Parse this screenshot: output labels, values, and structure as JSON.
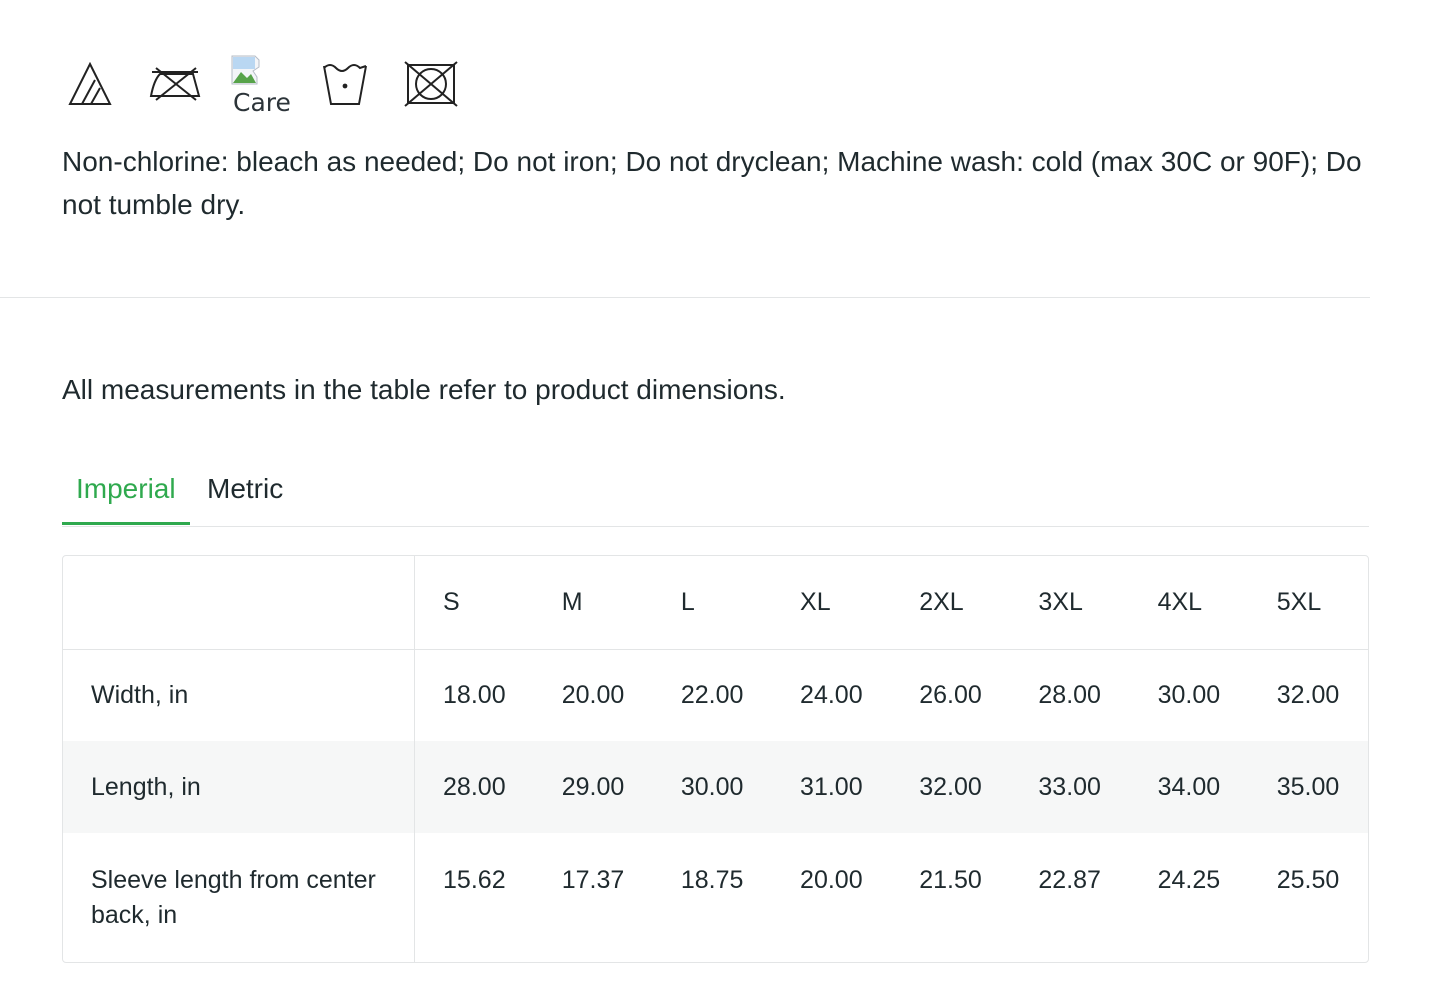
{
  "care": {
    "icons": [
      "non-chlorine-bleach-icon",
      "do-not-iron-icon",
      "broken-image-icon",
      "machine-wash-cold-icon",
      "do-not-tumble-dry-icon"
    ],
    "broken_image_alt": "Care",
    "instructions": "Non-chlorine: bleach as needed; Do not iron; Do not dryclean; Machine wash: cold (max 30C or 90F); Do not tumble dry."
  },
  "measurements": {
    "note": "All measurements in the table refer to product dimensions.",
    "tabs": [
      {
        "label": "Imperial",
        "active": true
      },
      {
        "label": "Metric",
        "active": false
      }
    ],
    "active_color": "#2fa94e",
    "sizes": [
      "S",
      "M",
      "L",
      "XL",
      "2XL",
      "3XL",
      "4XL",
      "5XL"
    ],
    "rows": [
      {
        "label": "Width, in",
        "values": [
          "18.00",
          "20.00",
          "22.00",
          "24.00",
          "26.00",
          "28.00",
          "30.00",
          "32.00"
        ]
      },
      {
        "label": "Length, in",
        "values": [
          "28.00",
          "29.00",
          "30.00",
          "31.00",
          "32.00",
          "33.00",
          "34.00",
          "35.00"
        ]
      },
      {
        "label": "Sleeve length from center back, in",
        "values": [
          "15.62",
          "17.37",
          "18.75",
          "20.00",
          "21.50",
          "22.87",
          "24.25",
          "25.50"
        ]
      }
    ]
  }
}
